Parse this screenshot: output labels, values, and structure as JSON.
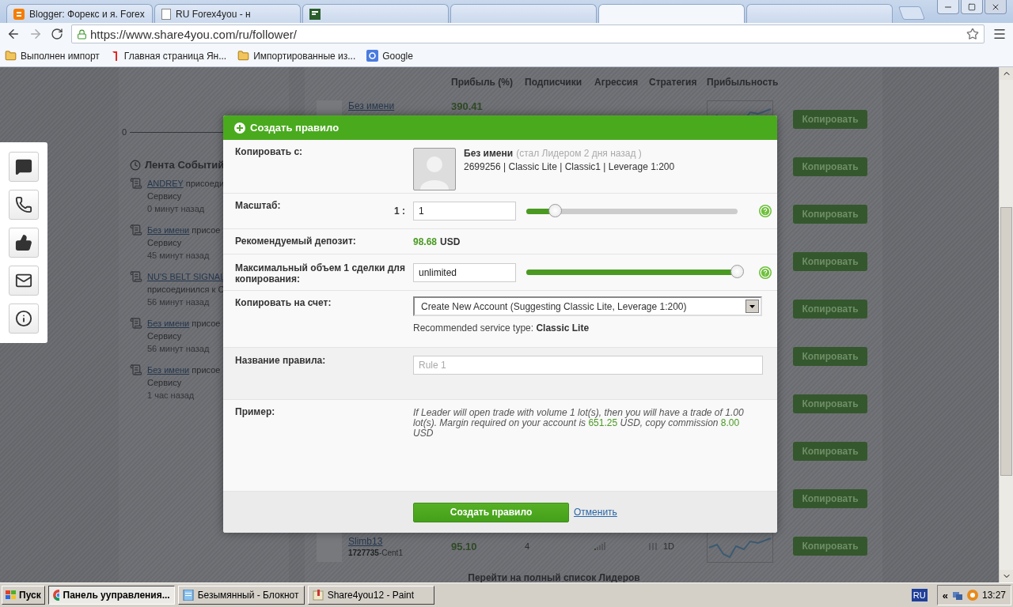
{
  "browser": {
    "tabs": [
      {
        "title": "Blogger: Форекс и я. Forex",
        "kind": "blogger",
        "selected": false
      },
      {
        "title": "RU Forex4you - н",
        "kind": "page",
        "selected": false
      },
      {
        "kind": "forex",
        "selected": false
      },
      {
        "kind": "blank",
        "selected": false
      },
      {
        "kind": "blank",
        "selected": true
      },
      {
        "kind": "blank",
        "selected": false
      }
    ],
    "address": "https://www.share4you.com/ru/follower/",
    "bookmarks": [
      {
        "label": "Выполнен импорт",
        "kind": "folder"
      },
      {
        "label": "Главная страница Ян...",
        "kind": "yandex"
      },
      {
        "label": "Импортированные из...",
        "kind": "folder"
      },
      {
        "label": "Google",
        "kind": "google"
      }
    ]
  },
  "page": {
    "axis_label": "0",
    "feed": {
      "title": "Лента Событий",
      "items": [
        {
          "user": "ANDREY",
          "rest": "присоеди",
          "lines": [
            "Сервису"
          ],
          "time": "0 минут назад"
        },
        {
          "user": "Без имени",
          "rest": "присое",
          "lines": [
            "Сервису"
          ],
          "time": "45 минут назад"
        },
        {
          "user": "NU'S BELT SIGNAL",
          "lines": [
            "присоединился к С"
          ],
          "time": "56 минут назад"
        },
        {
          "user": "Без имени",
          "rest": "присое",
          "lines": [
            "Сервису"
          ],
          "time": "56 минут назад"
        },
        {
          "user": "Без имени",
          "rest": "присое",
          "lines": [
            "Сервису"
          ],
          "time": "1 час назад"
        }
      ]
    },
    "table": {
      "columns": [
        "Прибыль (%)",
        "Подписчики",
        "Агрессия",
        "Стратегия",
        "Прибыльность"
      ],
      "rows": [
        {
          "name": "Без имени",
          "profit": "390.41",
          "button": "Копировать"
        },
        {
          "button": "Копировать"
        },
        {
          "button": "Копировать"
        },
        {
          "button": "Копировать"
        },
        {
          "button": "Копировать"
        },
        {
          "button": "Копировать"
        },
        {
          "button": "Копировать"
        },
        {
          "button": "Копировать"
        },
        {
          "button": "Копировать"
        },
        {
          "name": "Slimb13",
          "account": "1727735",
          "account_type": "-Cent1",
          "profit": "95.10",
          "subscribers": "4",
          "period": "1D",
          "button": "Копировать"
        }
      ],
      "footer_link": "Перейти на полный список Лидеров"
    }
  },
  "modal": {
    "title": "Создать правило",
    "copy_from": {
      "label": "Копировать с:",
      "leader_name": "Без имени",
      "leader_note": "(стал Лидером 2 дня назад )",
      "details": "2699256 | Classic Lite | Classic1 | Leverage 1:200"
    },
    "scale": {
      "label": "Масштаб:",
      "prefix": "1 :",
      "value": "1",
      "level": 0.14
    },
    "deposit": {
      "label": "Рекомендуемый депозит:",
      "amount": "98.68",
      "currency": "USD"
    },
    "max_volume": {
      "label": "Максимальный объем 1 сделки для копирования:",
      "value": "unlimited",
      "level": 1
    },
    "account": {
      "label": "Копировать на счет:",
      "value": "Create New Account (Suggesting Classic Lite, Leverage 1:200)",
      "hint": "Recommended service type: **Classic Lite**"
    },
    "rule_name": {
      "label": "Название правила:",
      "placeholder": "Rule 1"
    },
    "example": {
      "label": "Пример:",
      "segments": [
        {
          "text": "If Leader will open trade with volume 1 lot(s), then you will have a trade of 1.00 lot(s). Margin required on your account is ",
          "highlight": false
        },
        {
          "text": "651.25",
          "highlight": true
        },
        {
          "text": " USD, copy commission ",
          "highlight": false
        },
        {
          "text": "8.00",
          "highlight": true
        },
        {
          "text": " USD",
          "highlight": false
        }
      ]
    },
    "submit": "Создать правило",
    "cancel": "Отменить"
  },
  "taskbar": {
    "start": "Пуск",
    "tasks": [
      {
        "label": "Панель ууправления...",
        "kind": "chrome",
        "selected": true
      },
      {
        "label": "Безымянный - Блокнот",
        "kind": "notepad",
        "selected": false
      },
      {
        "label": "Share4you12 - Paint",
        "kind": "paint",
        "selected": false
      }
    ],
    "language": "RU",
    "tray_toggle": "«",
    "clock": "13:27"
  }
}
